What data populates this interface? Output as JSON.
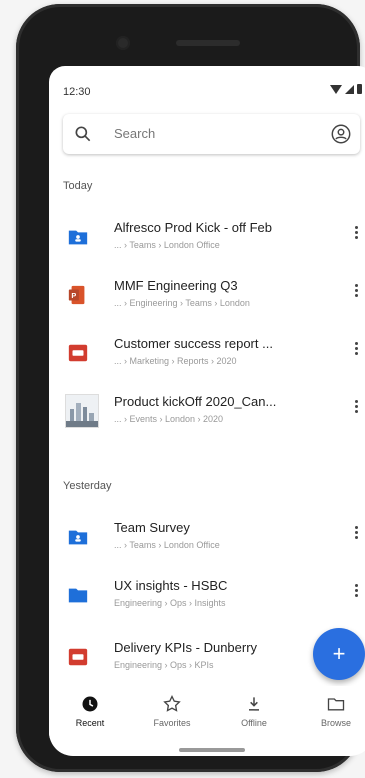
{
  "status_bar": {
    "time": "12:30"
  },
  "search": {
    "placeholder": "Search"
  },
  "sections": {
    "today": "Today",
    "yesterday": "Yesterday"
  },
  "today_items": [
    {
      "title": "Alfresco Prod Kick - off Feb",
      "path": "... › Teams › London Office",
      "icon": "folder-shared-icon"
    },
    {
      "title": "MMF Engineering Q3",
      "path": "... › Engineering › Teams › London",
      "icon": "powerpoint-icon"
    },
    {
      "title": "Customer success report ...",
      "path": "... › Marketing › Reports › 2020",
      "icon": "presentation-icon"
    },
    {
      "title": "Product kickOff 2020_Can...",
      "path": "... › Events › London › 2020",
      "icon": "image-thumbnail"
    }
  ],
  "yesterday_items": [
    {
      "title": "Team Survey",
      "path": "... › Teams › London Office",
      "icon": "folder-shared-icon"
    },
    {
      "title": "UX insights - HSBC",
      "path": "Engineering › Ops › Insights",
      "icon": "folder-icon"
    },
    {
      "title": "Delivery KPIs - Dunberry",
      "path": "Engineering › Ops › KPIs",
      "icon": "presentation-icon"
    }
  ],
  "fab": {
    "label": "+"
  },
  "bottom_nav": [
    {
      "label": "Recent",
      "icon": "clock-icon",
      "active": true
    },
    {
      "label": "Favorites",
      "icon": "star-icon",
      "active": false
    },
    {
      "label": "Offline",
      "icon": "download-icon",
      "active": false
    },
    {
      "label": "Browse",
      "icon": "folder-outline-icon",
      "active": false
    }
  ],
  "colors": {
    "accent": "#2a6fe0",
    "folder": "#1e6fd9",
    "presentation_red": "#d23c2f",
    "powerpoint_orange": "#d9532a"
  }
}
